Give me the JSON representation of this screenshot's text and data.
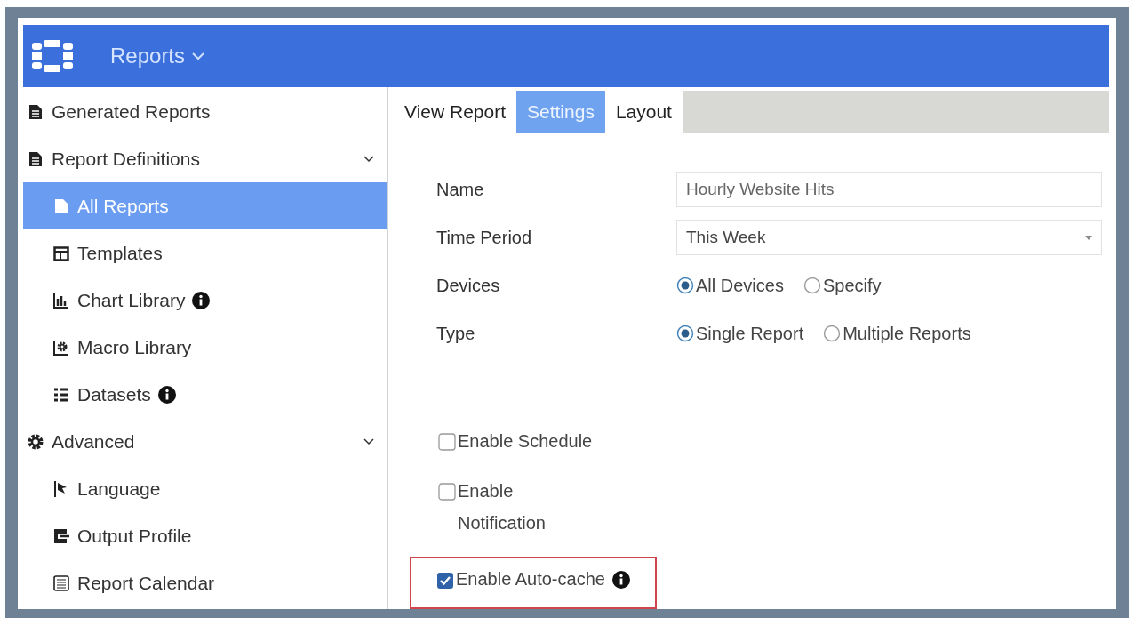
{
  "header": {
    "module": "Reports"
  },
  "sidebar": {
    "items": [
      {
        "label": "Generated Reports",
        "kind": "document",
        "selected": false,
        "info": false
      },
      {
        "label": "Report Definitions",
        "kind": "document",
        "selected": false,
        "info": false,
        "expanded": true,
        "children": [
          {
            "label": "All Reports",
            "kind": "document",
            "selected": true,
            "info": false
          },
          {
            "label": "Templates",
            "kind": "template",
            "selected": false,
            "info": false
          },
          {
            "label": "Chart Library",
            "kind": "chart",
            "selected": false,
            "info": true
          },
          {
            "label": "Macro Library",
            "kind": "macro",
            "selected": false,
            "info": false
          },
          {
            "label": "Datasets",
            "kind": "dataset",
            "selected": false,
            "info": true
          }
        ]
      },
      {
        "label": "Advanced",
        "kind": "gear",
        "selected": false,
        "info": false,
        "expanded": true,
        "children": [
          {
            "label": "Language",
            "kind": "flag",
            "selected": false,
            "info": false
          },
          {
            "label": "Output Profile",
            "kind": "output",
            "selected": false,
            "info": false
          },
          {
            "label": "Report Calendar",
            "kind": "calendar",
            "selected": false,
            "info": false
          }
        ]
      }
    ]
  },
  "tabs": [
    {
      "label": "View Report",
      "selected": false
    },
    {
      "label": "Settings",
      "selected": true
    },
    {
      "label": "Layout",
      "selected": false
    }
  ],
  "form": {
    "fields": [
      {
        "kind": "text",
        "label": "Name",
        "value": "Hourly Website Hits"
      },
      {
        "kind": "select",
        "label": "Time Period",
        "value": "This Week"
      },
      {
        "kind": "radio",
        "label": "Devices",
        "options": [
          {
            "label": "All Devices",
            "selected": true
          },
          {
            "label": "Specify",
            "selected": false
          }
        ]
      },
      {
        "kind": "radio",
        "label": "Type",
        "options": [
          {
            "label": "Single Report",
            "selected": true
          },
          {
            "label": "Multiple Reports",
            "selected": false
          }
        ]
      }
    ],
    "checkboxes": [
      {
        "label": "Enable Schedule",
        "checked": false,
        "info": false,
        "highlighted": false
      },
      {
        "label": "Enable Notification",
        "checked": false,
        "info": false,
        "highlighted": false
      },
      {
        "label": "Enable Auto-cache",
        "checked": true,
        "info": true,
        "highlighted": true
      }
    ]
  }
}
